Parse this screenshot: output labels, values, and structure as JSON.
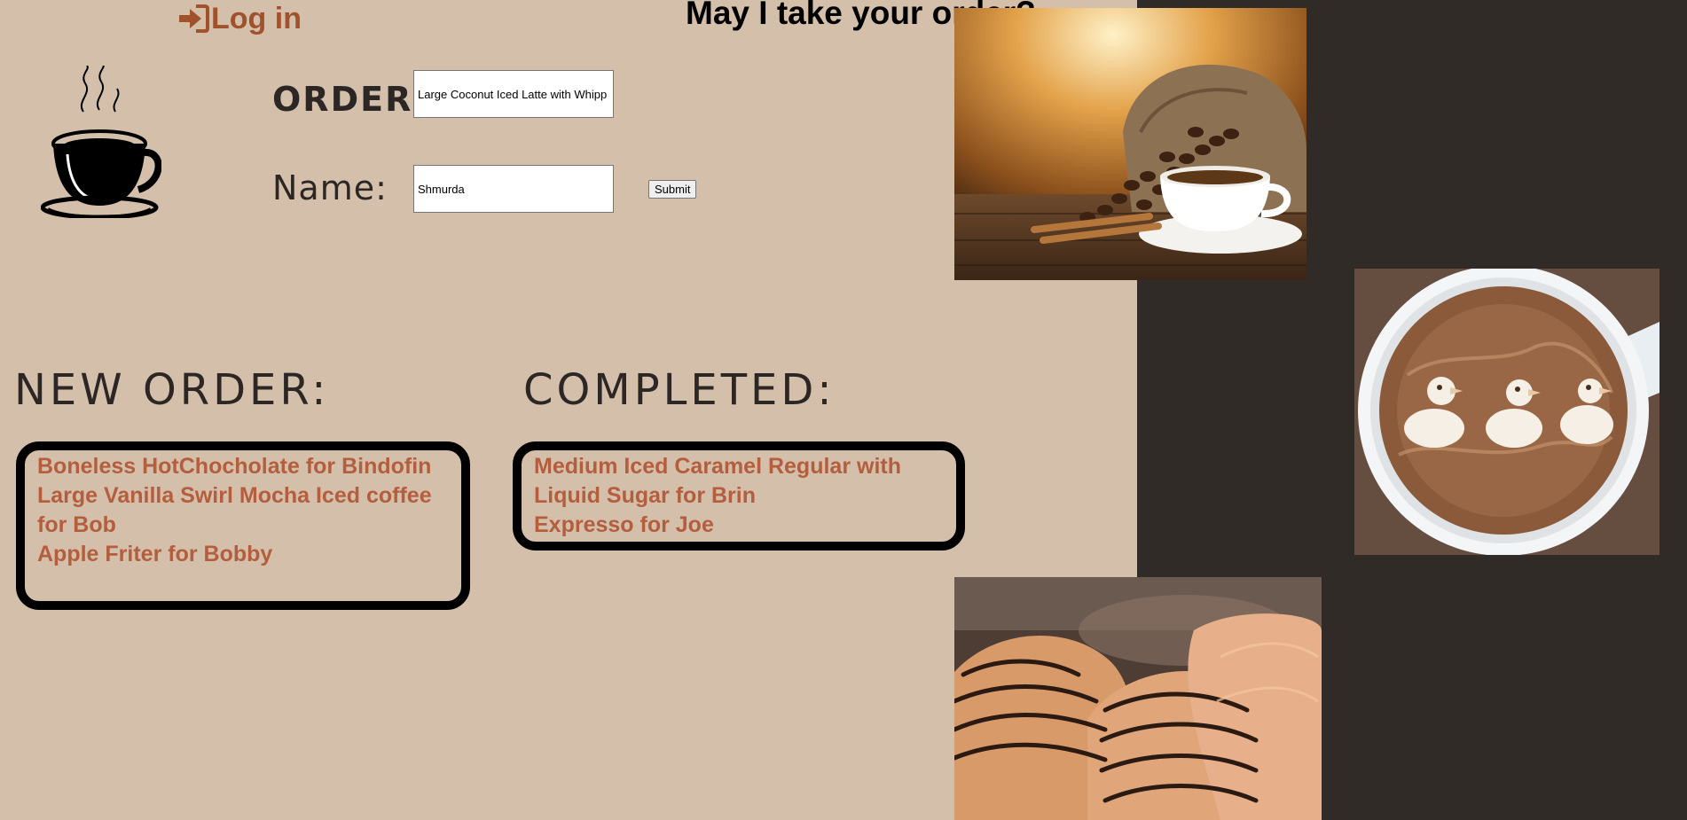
{
  "header": {
    "login_label": "Log in",
    "login_icon": "sign-in-icon",
    "headline": "May I take your order?"
  },
  "logo": {
    "icon": "coffee-cup-icon"
  },
  "form": {
    "order_label": "ORDER:",
    "order_value": "Large Coconut Iced Latte with Whipp",
    "name_label": "Name:",
    "name_value": "Shmurda",
    "submit_label": "Submit"
  },
  "new_orders": {
    "title": "NEW ORDER:",
    "items": [
      "Boneless HotChocholate for Bindofin",
      "Large Vanilla Swirl Mocha Iced coffee for Bob",
      "Apple Friter for Bobby"
    ]
  },
  "completed_orders": {
    "title": "COMPLETED:",
    "items": [
      "Medium Iced Caramel Regular with Liquid Sugar for Brin",
      "Expresso for Joe"
    ]
  },
  "images": {
    "beans": "coffee-beans-photo",
    "latte": "latte-art-ducks-photo",
    "pastry": "croissants-photo"
  },
  "colors": {
    "page_bg": "#d3bfaa",
    "dark_panel": "#312b27",
    "accent": "#a0522d",
    "order_text": "#b45e3e"
  }
}
